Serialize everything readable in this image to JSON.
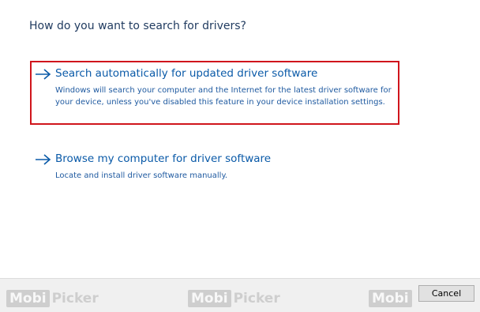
{
  "dialog": {
    "question": "How do you want to search for drivers?"
  },
  "options": [
    {
      "title": "Search automatically for updated driver software",
      "description": "Windows will search your computer and the Internet for the latest driver software for your device, unless you've disabled this feature in your device installation settings.",
      "icon": "arrow-right-icon",
      "highlighted": true
    },
    {
      "title": "Browse my computer for driver software",
      "description": "Locate and install driver software manually.",
      "icon": "arrow-right-icon",
      "highlighted": false
    }
  ],
  "footer": {
    "cancel_label": "Cancel"
  },
  "watermark": {
    "box_text": "Mobi",
    "text": "Picker"
  },
  "colors": {
    "link_blue": "#0a5aa8",
    "highlight_red": "#d0151c",
    "heading": "#1f3a5f"
  }
}
